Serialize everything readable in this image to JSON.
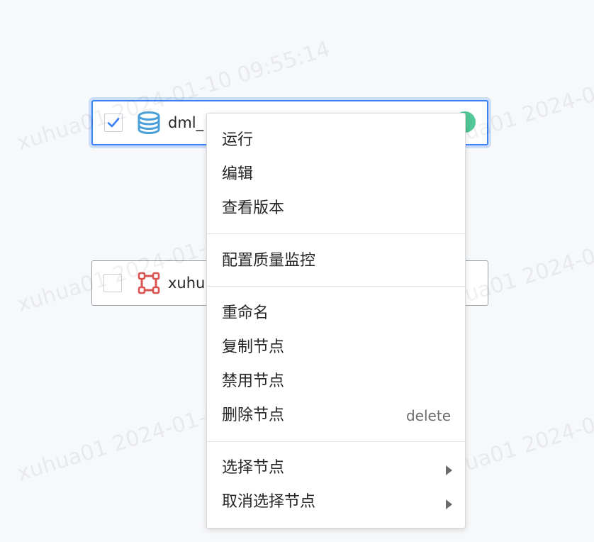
{
  "watermark": {
    "text": "xuhua01 2024-01-10 09:55:14"
  },
  "nodes": [
    {
      "label": "dml_",
      "checked": true,
      "icon": "database-icon",
      "status_color": "#52c797"
    },
    {
      "label": "xuhu",
      "checked": false,
      "icon": "node-shape-icon",
      "icon_color": "#d9534f"
    }
  ],
  "context_menu": {
    "groups": [
      [
        {
          "label": "运行"
        },
        {
          "label": "编辑"
        },
        {
          "label": "查看版本"
        }
      ],
      [
        {
          "label": "配置质量监控"
        }
      ],
      [
        {
          "label": "重命名"
        },
        {
          "label": "复制节点"
        },
        {
          "label": "禁用节点"
        },
        {
          "label": "删除节点",
          "shortcut": "delete"
        }
      ],
      [
        {
          "label": "选择节点",
          "submenu": true
        },
        {
          "label": "取消选择节点",
          "submenu": true
        }
      ]
    ]
  },
  "colors": {
    "selected_border": "#3b82f6",
    "checkbox_check": "#3b82f6",
    "status_green": "#52c797",
    "node_icon_red": "#d9534f",
    "database_blue": "#4a9fd8"
  }
}
